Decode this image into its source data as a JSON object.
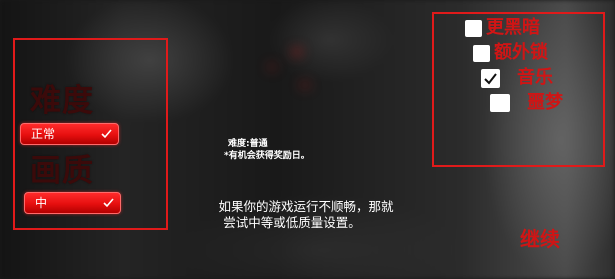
{
  "settings": {
    "difficulty_heading": "难度",
    "difficulty_value": "正常",
    "quality_heading": "画质",
    "quality_value": "中"
  },
  "options": [
    {
      "label": "更黑暗",
      "checked": false
    },
    {
      "label": "额外锁",
      "checked": false
    },
    {
      "label": "音乐",
      "checked": true
    },
    {
      "label": "噩梦",
      "checked": false
    }
  ],
  "info": {
    "difficulty_line": "难度:普通",
    "reward_line": "*有机会获得奖励日。"
  },
  "hint": {
    "line1": "如果你的游戏运行不顺畅，那就",
    "line2": "尝试中等或低质量设置。"
  },
  "continue_label": "继续",
  "colors": {
    "accent_red": "#e01a1a",
    "label_red": "#d01515",
    "heading_dark_red": "#3b0a0a"
  }
}
